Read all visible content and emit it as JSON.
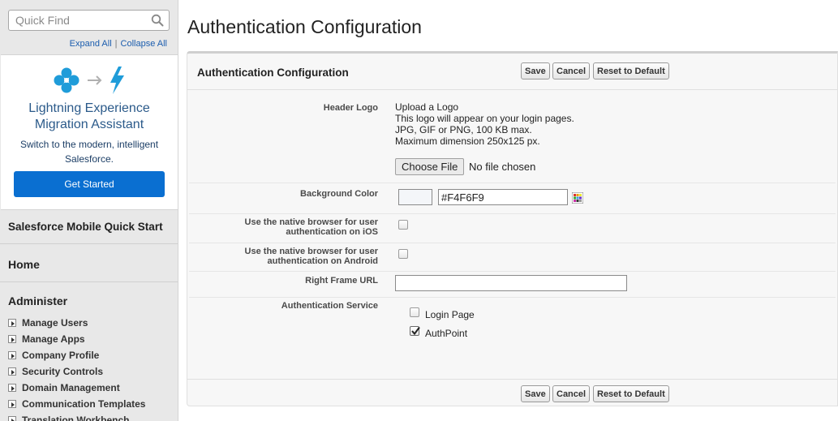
{
  "sidebar": {
    "search_placeholder": "Quick Find",
    "expand_all": "Expand All",
    "separator": "|",
    "collapse_all": "Collapse All",
    "promo": {
      "title": "Lightning Experience Migration Assistant",
      "subtitle": "Switch to the modern, intelligent Salesforce.",
      "button": "Get Started"
    },
    "mobile_quick_start": "Salesforce Mobile Quick Start",
    "home": "Home",
    "administer": "Administer",
    "admin_items": [
      "Manage Users",
      "Manage Apps",
      "Company Profile",
      "Security Controls",
      "Domain Management",
      "Communication Templates",
      "Translation Workbench"
    ]
  },
  "page": {
    "title": "Authentication Configuration"
  },
  "panel": {
    "title": "Authentication Configuration",
    "buttons": {
      "save": "Save",
      "cancel": "Cancel",
      "reset": "Reset to Default"
    },
    "fields": {
      "header_logo": {
        "label": "Header Logo",
        "line1": "Upload a Logo",
        "line2": "This logo will appear on your login pages.",
        "line3": "JPG, GIF or PNG, 100 KB max.",
        "line4": "Maximum dimension 250x125 px.",
        "choose_file": "Choose File",
        "no_file": "No file chosen"
      },
      "background_color": {
        "label": "Background Color",
        "value": "#F4F6F9",
        "swatch_color": "#F4F6F9"
      },
      "native_ios": {
        "label_line1": "Use the native browser for user",
        "label_line2": "authentication on iOS",
        "checked": false
      },
      "native_android": {
        "label_line1": "Use the native browser for user",
        "label_line2": "authentication on Android",
        "checked": false
      },
      "right_frame_url": {
        "label": "Right Frame URL",
        "value": ""
      },
      "authentication_service": {
        "label": "Authentication Service",
        "options": [
          {
            "label": "Login Page",
            "checked": false
          },
          {
            "label": "AuthPoint",
            "checked": true
          }
        ]
      }
    }
  },
  "colors": {
    "accent_blue": "#0a6fd1",
    "link_blue": "#1b5dae",
    "promo_icon_blue": "#1f9cd9"
  }
}
